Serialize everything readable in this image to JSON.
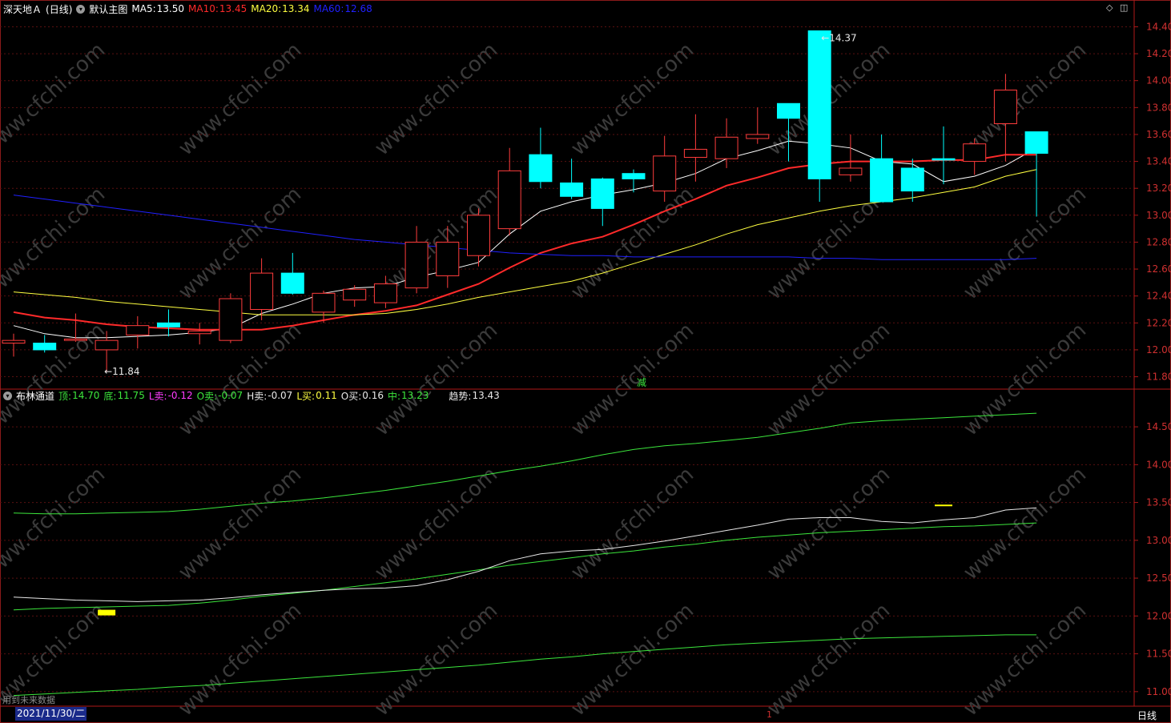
{
  "main_panel": {
    "stock_name": "深天地Ａ",
    "period_label": "(日线)",
    "view_label": "默认主图",
    "indicators": [
      {
        "label": "MA5:",
        "value": "13.50",
        "color": "#ffffff"
      },
      {
        "label": "MA10:",
        "value": "13.45",
        "color": "#ff2a2a"
      },
      {
        "label": "MA20:",
        "value": "13.34",
        "color": "#ffff40"
      },
      {
        "label": "MA60:",
        "value": "12.68",
        "color": "#2020ff"
      }
    ],
    "high_marker": "14.37",
    "low_marker": "11.84",
    "event_label": "减",
    "axis_ticks": [
      "14.40",
      "14.20",
      "14.00",
      "13.80",
      "13.60",
      "13.40",
      "13.20",
      "13.00",
      "12.80",
      "12.60",
      "12.40",
      "12.20",
      "12.00",
      "11.80"
    ]
  },
  "sub_panel": {
    "name": "布林通道",
    "indicators": [
      {
        "label": "顶:",
        "value": "14.70",
        "color": "#3ce63c"
      },
      {
        "label": "底:",
        "value": "11.75",
        "color": "#3ce63c"
      },
      {
        "label": "L卖:",
        "value": "-0.12",
        "color": "#ff3cff"
      },
      {
        "label": "O卖:",
        "value": "-0.07",
        "color": "#3ce63c"
      },
      {
        "label": "H卖:",
        "value": "-0.07",
        "color": "#e8e8e8"
      },
      {
        "label": "L买:",
        "value": "0.11",
        "color": "#ffff40"
      },
      {
        "label": "O买:",
        "value": "0.16",
        "color": "#e8e8e8"
      },
      {
        "label": "中:",
        "value": "13.23",
        "color": "#3ce63c"
      },
      {
        "label": "趋势:",
        "value": "13.43",
        "color": "#e8e8e8"
      }
    ],
    "axis_ticks": [
      "14.50",
      "14.00",
      "13.50",
      "13.00",
      "12.50",
      "12.00",
      "11.50",
      "11.00"
    ]
  },
  "footer": {
    "date": "2021/11/30/二",
    "future_data_label": "用到未来数据",
    "period_button": "日线",
    "cursor_marker": "1"
  },
  "watermark_text": "www.cfchi.com",
  "chart_data": [
    {
      "type": "candlestick",
      "title": "深天地Ａ (日线)",
      "ylim": [
        11.72,
        14.48
      ],
      "grid": true,
      "up_color": "#ff3c3c",
      "down_color": "#00ffff",
      "ohlc": [
        [
          12.05,
          12.12,
          11.95,
          12.07
        ],
        [
          12.05,
          12.11,
          11.98,
          12.0
        ],
        [
          12.07,
          12.27,
          12.06,
          12.08
        ],
        [
          12.0,
          12.14,
          11.84,
          12.07
        ],
        [
          12.11,
          12.25,
          12.01,
          12.18
        ],
        [
          12.2,
          12.3,
          12.1,
          12.17
        ],
        [
          12.12,
          12.2,
          12.04,
          12.14
        ],
        [
          12.07,
          12.42,
          12.05,
          12.38
        ],
        [
          12.3,
          12.68,
          12.22,
          12.57
        ],
        [
          12.57,
          12.72,
          12.41,
          12.42
        ],
        [
          12.28,
          12.44,
          12.2,
          12.42
        ],
        [
          12.37,
          12.48,
          12.32,
          12.45
        ],
        [
          12.35,
          12.55,
          12.31,
          12.49
        ],
        [
          12.46,
          12.92,
          12.42,
          12.8
        ],
        [
          12.55,
          12.92,
          12.46,
          12.8
        ],
        [
          12.7,
          13.05,
          12.62,
          13.0
        ],
        [
          12.9,
          13.5,
          12.85,
          13.33
        ],
        [
          13.45,
          13.65,
          13.2,
          13.25
        ],
        [
          13.24,
          13.42,
          13.12,
          13.14
        ],
        [
          13.27,
          13.28,
          12.92,
          13.05
        ],
        [
          13.31,
          13.34,
          13.17,
          13.27
        ],
        [
          13.18,
          13.59,
          13.1,
          13.44
        ],
        [
          13.43,
          13.75,
          13.25,
          13.49
        ],
        [
          13.42,
          13.72,
          13.35,
          13.58
        ],
        [
          13.57,
          13.8,
          13.53,
          13.6
        ],
        [
          13.83,
          13.83,
          13.4,
          13.72
        ],
        [
          14.37,
          14.37,
          13.1,
          13.27
        ],
        [
          13.3,
          13.6,
          13.25,
          13.35
        ],
        [
          13.42,
          13.6,
          13.1,
          13.1
        ],
        [
          13.35,
          13.42,
          13.1,
          13.18
        ],
        [
          13.42,
          13.66,
          13.23,
          13.41
        ],
        [
          13.4,
          13.57,
          13.3,
          13.53
        ],
        [
          13.68,
          14.05,
          13.4,
          13.93
        ],
        [
          13.62,
          13.62,
          12.99,
          13.46
        ]
      ],
      "series": [
        {
          "name": "MA5",
          "color": "#ffffff",
          "values": [
            12.18,
            12.12,
            12.09,
            12.09,
            12.1,
            12.11,
            12.13,
            12.16,
            12.27,
            12.34,
            12.42,
            12.46,
            12.47,
            12.54,
            12.59,
            12.65,
            12.86,
            13.03,
            13.1,
            13.15,
            13.19,
            13.24,
            13.31,
            13.42,
            13.48,
            13.55,
            13.53,
            13.5,
            13.4,
            13.38,
            13.25,
            13.29,
            13.37,
            13.5
          ]
        },
        {
          "name": "MA10",
          "color": "#ff2a2a",
          "values": [
            12.28,
            12.24,
            12.22,
            12.19,
            12.17,
            12.16,
            12.15,
            12.15,
            12.15,
            12.18,
            12.22,
            12.26,
            12.29,
            12.33,
            12.41,
            12.49,
            12.61,
            12.72,
            12.79,
            12.84,
            12.93,
            13.03,
            13.12,
            13.22,
            13.28,
            13.35,
            13.38,
            13.4,
            13.4,
            13.4,
            13.41,
            13.41,
            13.45,
            13.45
          ]
        },
        {
          "name": "MA20",
          "color": "#ffff40",
          "values": [
            12.43,
            12.41,
            12.39,
            12.36,
            12.34,
            12.32,
            12.3,
            12.28,
            12.26,
            12.26,
            12.26,
            12.26,
            12.27,
            12.3,
            12.34,
            12.39,
            12.43,
            12.47,
            12.51,
            12.57,
            12.64,
            12.71,
            12.78,
            12.86,
            12.93,
            12.98,
            13.03,
            13.07,
            13.1,
            13.13,
            13.17,
            13.21,
            13.29,
            13.34
          ]
        },
        {
          "name": "MA60",
          "color": "#2020ff",
          "values": [
            13.15,
            13.12,
            13.09,
            13.06,
            13.03,
            13.0,
            12.97,
            12.94,
            12.91,
            12.88,
            12.85,
            12.82,
            12.8,
            12.78,
            12.76,
            12.74,
            12.72,
            12.71,
            12.7,
            12.7,
            12.69,
            12.69,
            12.69,
            12.69,
            12.69,
            12.69,
            12.68,
            12.68,
            12.67,
            12.67,
            12.67,
            12.67,
            12.67,
            12.68
          ]
        }
      ]
    },
    {
      "type": "line",
      "title": "布林通道",
      "ylim": [
        10.85,
        14.85
      ],
      "grid": true,
      "series": [
        {
          "name": "顶",
          "color": "#3ce63c",
          "values": [
            13.36,
            13.35,
            13.35,
            13.36,
            13.37,
            13.38,
            13.41,
            13.45,
            13.49,
            13.52,
            13.56,
            13.61,
            13.66,
            13.72,
            13.78,
            13.85,
            13.92,
            13.98,
            14.05,
            14.13,
            14.2,
            14.25,
            14.28,
            14.32,
            14.36,
            14.42,
            14.48,
            14.55,
            14.58,
            14.6,
            14.62,
            14.64,
            14.66,
            14.68
          ]
        },
        {
          "name": "中",
          "color": "#3ce63c",
          "values": [
            12.08,
            12.1,
            12.11,
            12.12,
            12.13,
            12.14,
            12.17,
            12.21,
            12.26,
            12.3,
            12.34,
            12.39,
            12.44,
            12.49,
            12.55,
            12.61,
            12.67,
            12.72,
            12.77,
            12.82,
            12.86,
            12.91,
            12.95,
            13.0,
            13.04,
            13.07,
            13.1,
            13.12,
            13.14,
            13.16,
            13.18,
            13.19,
            13.21,
            13.23
          ]
        },
        {
          "name": "底",
          "color": "#3ce63c",
          "values": [
            10.95,
            10.97,
            10.99,
            11.01,
            11.03,
            11.06,
            11.08,
            11.11,
            11.14,
            11.17,
            11.2,
            11.23,
            11.26,
            11.29,
            11.32,
            11.35,
            11.39,
            11.43,
            11.46,
            11.5,
            11.53,
            11.56,
            11.59,
            11.62,
            11.64,
            11.66,
            11.68,
            11.7,
            11.71,
            11.72,
            11.73,
            11.74,
            11.75,
            11.75
          ]
        },
        {
          "name": "趋势",
          "color": "#e8e8e8",
          "values": [
            12.25,
            12.23,
            12.21,
            12.2,
            12.19,
            12.2,
            12.21,
            12.24,
            12.28,
            12.31,
            12.34,
            12.36,
            12.37,
            12.4,
            12.48,
            12.59,
            12.73,
            12.82,
            12.86,
            12.88,
            12.93,
            12.99,
            13.06,
            13.13,
            13.2,
            13.28,
            13.3,
            13.3,
            13.25,
            13.23,
            13.27,
            13.3,
            13.4,
            13.43
          ]
        }
      ],
      "markers": [
        {
          "index": 3,
          "value": 12.05,
          "color": "#ffff00"
        },
        {
          "index": 30,
          "value": 13.44,
          "color": "#ffff00"
        }
      ]
    }
  ]
}
